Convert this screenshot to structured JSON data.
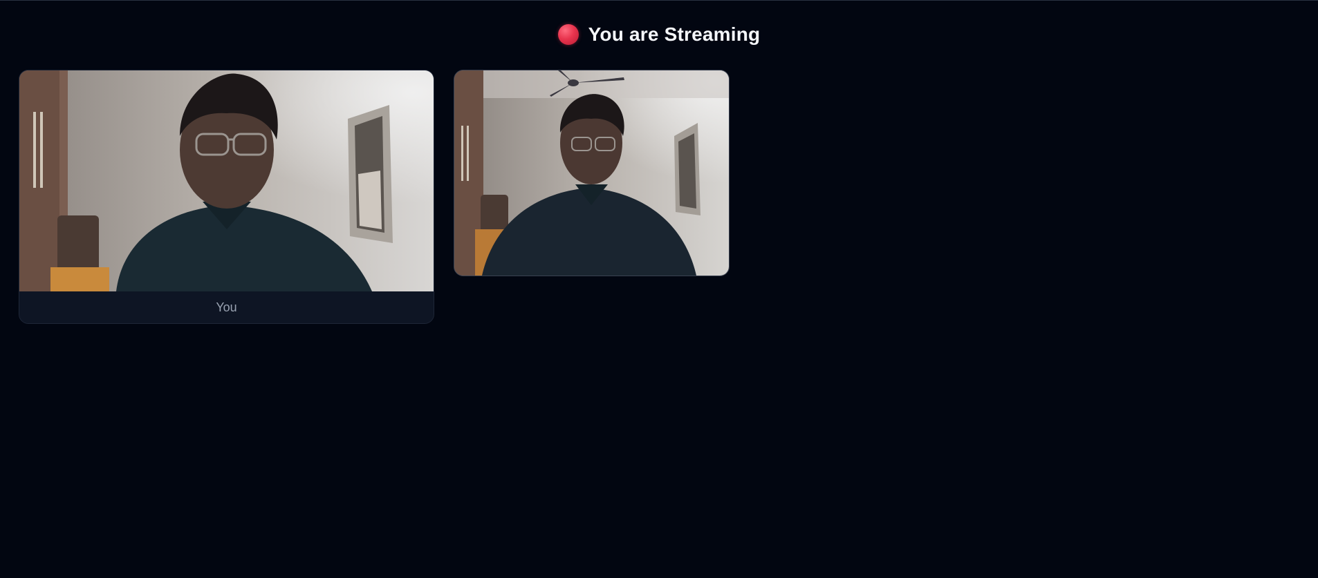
{
  "header": {
    "status_icon": "recording-dot-icon",
    "status_color": "#e8344e",
    "title": "You are Streaming"
  },
  "tiles": [
    {
      "label": "You",
      "content": "local-camera-video"
    },
    {
      "label": "",
      "content": "remote-camera-video"
    }
  ],
  "colors": {
    "background": "#020611",
    "tile_caption_bg": "#0e1524",
    "caption_text": "#9aa3b2"
  }
}
